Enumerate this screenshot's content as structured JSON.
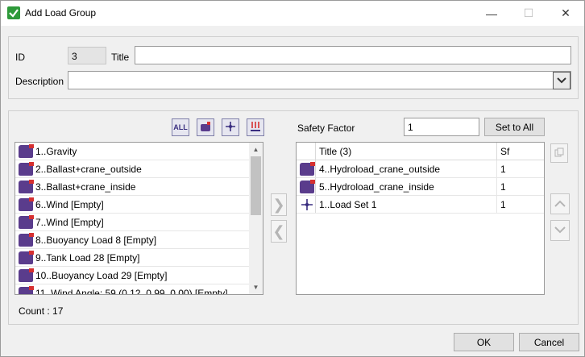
{
  "window": {
    "title": "Add Load Group",
    "minimize": "—",
    "maximize": "☐",
    "close": "✕"
  },
  "form": {
    "id_label": "ID",
    "id_value": "3",
    "title_label": "Title",
    "title_value": "",
    "description_label": "Description",
    "description_value": ""
  },
  "toolbar": {
    "all_label": "ALL"
  },
  "available": {
    "items": [
      {
        "label": "1..Gravity",
        "icon": "load-icon"
      },
      {
        "label": "2..Ballast+crane_outside",
        "icon": "load-icon"
      },
      {
        "label": "3..Ballast+crane_inside",
        "icon": "load-icon"
      },
      {
        "label": "6..Wind [Empty]",
        "icon": "load-icon"
      },
      {
        "label": "7..Wind [Empty]",
        "icon": "load-icon"
      },
      {
        "label": "8..Buoyancy Load 8 [Empty]",
        "icon": "load-icon"
      },
      {
        "label": "9..Tank Load 28 [Empty]",
        "icon": "load-icon"
      },
      {
        "label": "10..Buoyancy Load 29 [Empty]",
        "icon": "load-icon"
      },
      {
        "label": "11..Wind Angle: 59 (0.12, 0.99, 0.00) [Empty]",
        "icon": "load-icon"
      }
    ],
    "count_text": "Count : 17"
  },
  "safety": {
    "label": "Safety Factor",
    "value": "1",
    "set_all_label": "Set to All"
  },
  "selected": {
    "header_title": "Title (3)",
    "header_sf": "Sf",
    "rows": [
      {
        "title": "4..Hydroload_crane_outside",
        "sf": "1",
        "icon": "load-icon"
      },
      {
        "title": "5..Hydroload_crane_inside",
        "sf": "1",
        "icon": "load-icon"
      },
      {
        "title": "1..Load Set 1",
        "sf": "1",
        "icon": "load-set-icon"
      }
    ]
  },
  "buttons": {
    "ok": "OK",
    "cancel": "Cancel"
  },
  "colors": {
    "accent_purple": "#5a3c8c",
    "accent_red": "#d63030",
    "check_green": "#2e9a3a"
  }
}
